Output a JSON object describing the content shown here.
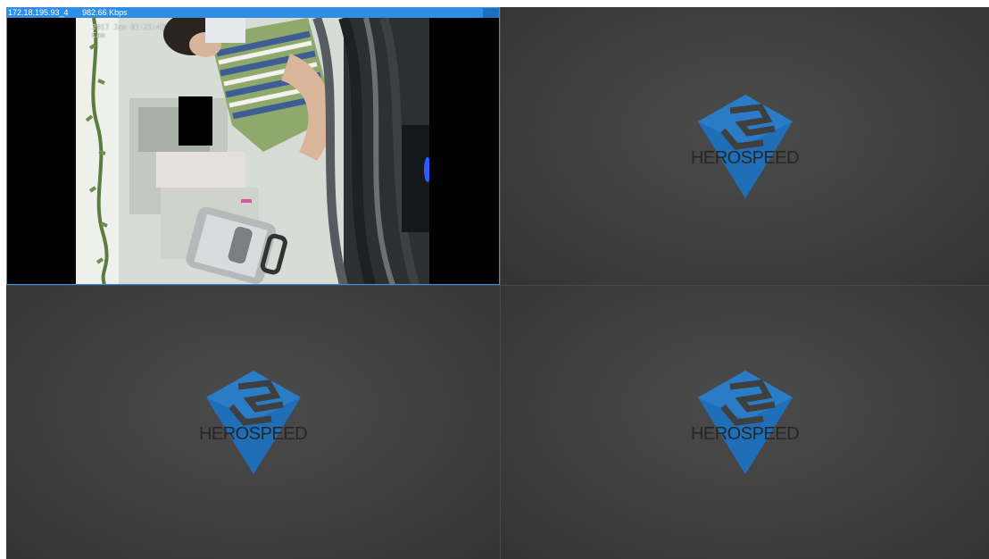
{
  "channel1": {
    "address": "172.18.195.93_4",
    "bitrate": "982.66 Kbps",
    "osd_datetime": "2017 Jan 01:25:43",
    "osd_line2": "Cam"
  },
  "placeholder": {
    "brand": "HEROSPEED"
  },
  "colors": {
    "title_bar": "#2f8de4",
    "logo_blue": "#2a7cc7",
    "empty_bg": "#404040"
  }
}
